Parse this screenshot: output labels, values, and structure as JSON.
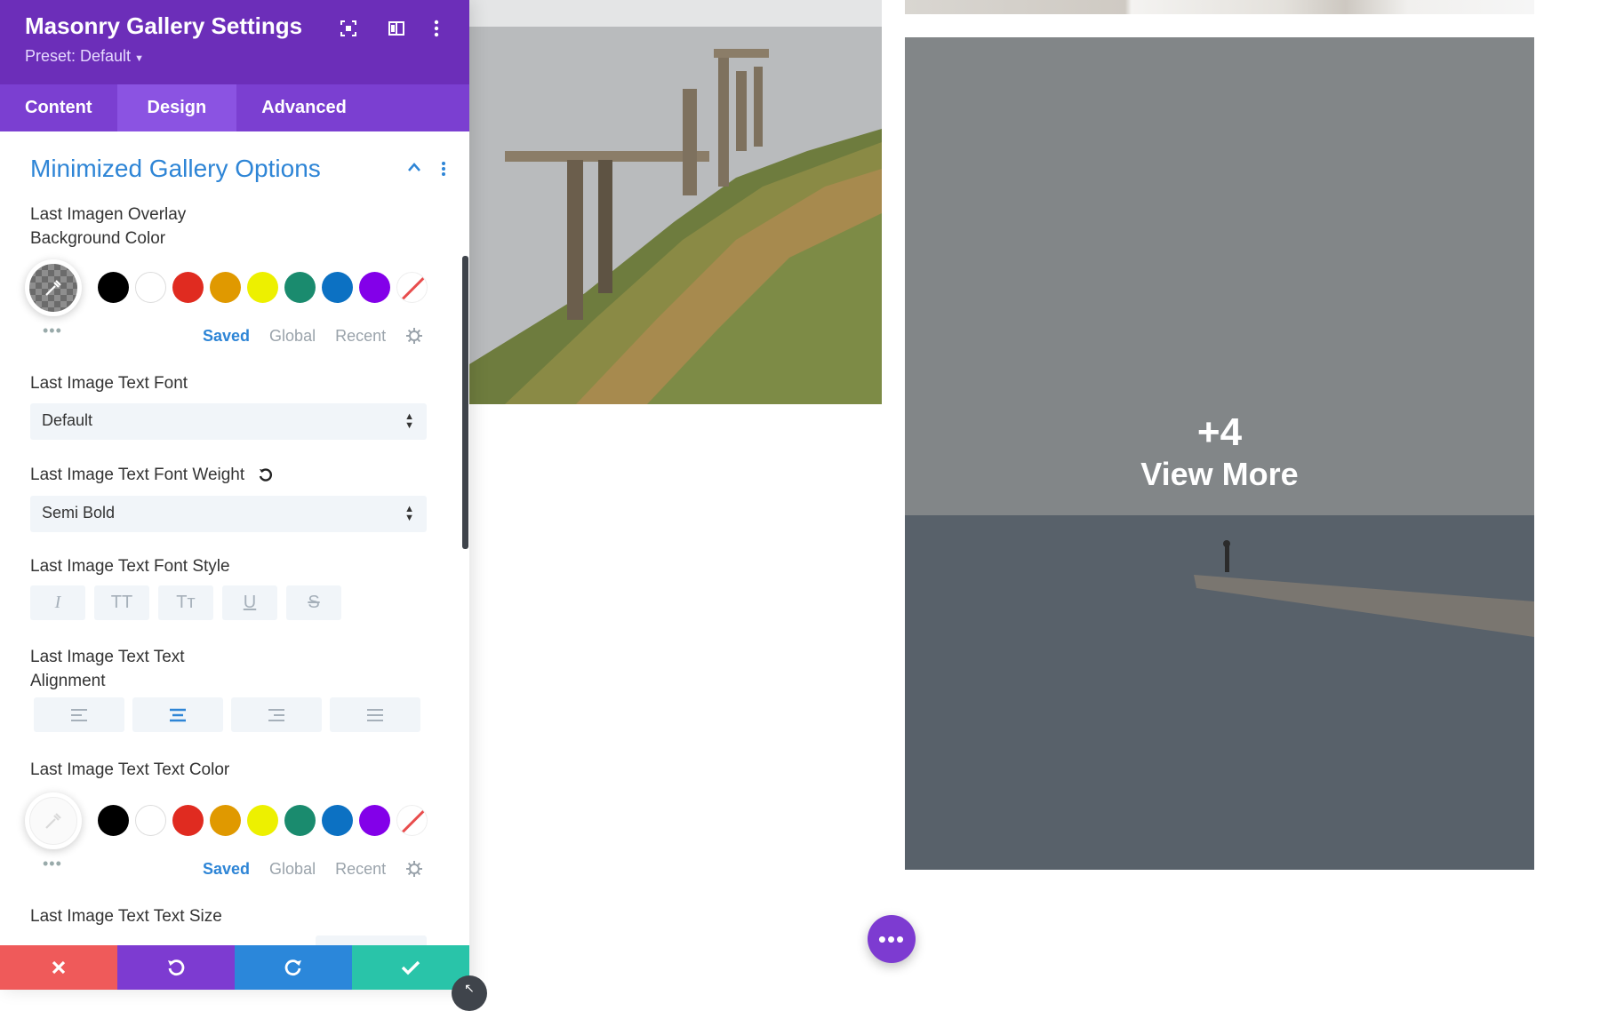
{
  "panel": {
    "title": "Masonry Gallery Settings",
    "preset": "Preset: Default",
    "header_icons": [
      "focus-icon",
      "split-view-icon",
      "more-vertical-icon"
    ],
    "tabs": [
      {
        "label": "Content",
        "active": false
      },
      {
        "label": "Design",
        "active": true
      },
      {
        "label": "Advanced",
        "active": false
      }
    ]
  },
  "section": {
    "title": "Minimized Gallery Options",
    "overlay_bg_label": "Last Imagen Overlay\nBackground Color",
    "font_label": "Last Image Text Font",
    "font_value": "Default",
    "weight_label": "Last Image Text Font Weight",
    "weight_value": "Semi Bold",
    "style_label": "Last Image Text Font Style",
    "style_buttons": [
      "I",
      "TT",
      "Tт",
      "U",
      "S"
    ],
    "align_label": "Last Image Text Text\nAlignment",
    "align_selected": "center",
    "text_color_label": "Last Image Text Text Color",
    "text_size_label": "Last Image Text Text Size"
  },
  "color_picker": {
    "swatches": [
      "#000000",
      "#ffffff",
      "#e02b20",
      "#e09900",
      "#edf000",
      "#1a8b6e",
      "#0c71c3",
      "#8300e9"
    ],
    "tabs": [
      "Saved",
      "Global",
      "Recent"
    ],
    "active_tab": "Saved"
  },
  "footer": {
    "buttons": [
      "close-icon",
      "undo-icon",
      "redo-icon",
      "check-icon"
    ]
  },
  "gallery": {
    "last_image_count": "+4",
    "last_image_text": "View More"
  },
  "colors": {
    "header_purple": "#6c2eb9",
    "tab_bar": "#7b3fd1",
    "accent_blue": "#2e85d6",
    "close_red": "#ef5a5a",
    "save_green": "#29c4a9"
  }
}
